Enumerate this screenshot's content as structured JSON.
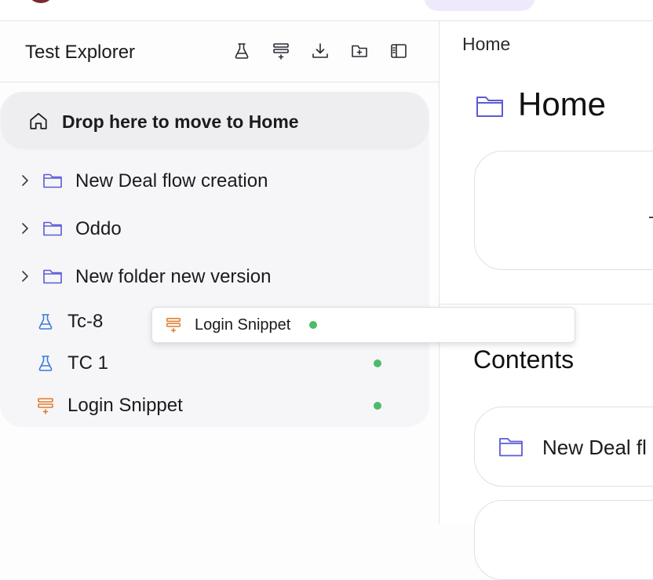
{
  "sidebar": {
    "title": "Test Explorer",
    "toolbar": [
      {
        "icon": "flask-icon"
      },
      {
        "icon": "add-snippet-icon"
      },
      {
        "icon": "download-icon"
      },
      {
        "icon": "new-folder-icon"
      },
      {
        "icon": "sidebar-toggle-icon"
      }
    ],
    "drop_zone": {
      "icon": "home-icon",
      "label": "Drop here to move to Home"
    },
    "folders": [
      {
        "label": "New Deal flow creation",
        "icon": "folder-icon"
      },
      {
        "label": "Oddo",
        "icon": "folder-icon"
      },
      {
        "label": "New folder new version",
        "icon": "folder-icon"
      }
    ],
    "items": [
      {
        "label": "Tc-8",
        "icon": "flask-icon",
        "status": ""
      },
      {
        "label": "TC 1",
        "icon": "flask-icon",
        "status": "green"
      },
      {
        "label": "Login Snippet",
        "icon": "snippet-icon",
        "status": "green"
      }
    ]
  },
  "drag_ghost": {
    "label": "Login Snippet",
    "icon": "snippet-icon",
    "status": "green"
  },
  "main": {
    "breadcrumb": "Home",
    "title": "Home",
    "contents_title": "Contents",
    "contents": [
      {
        "label": "New Deal fl",
        "icon": "folder-icon"
      }
    ]
  },
  "colors": {
    "folder": "#5b5bd6",
    "test_case": "#3b7bd8",
    "snippet": "#e07a2a",
    "status_ok": "#4cbb6a"
  }
}
